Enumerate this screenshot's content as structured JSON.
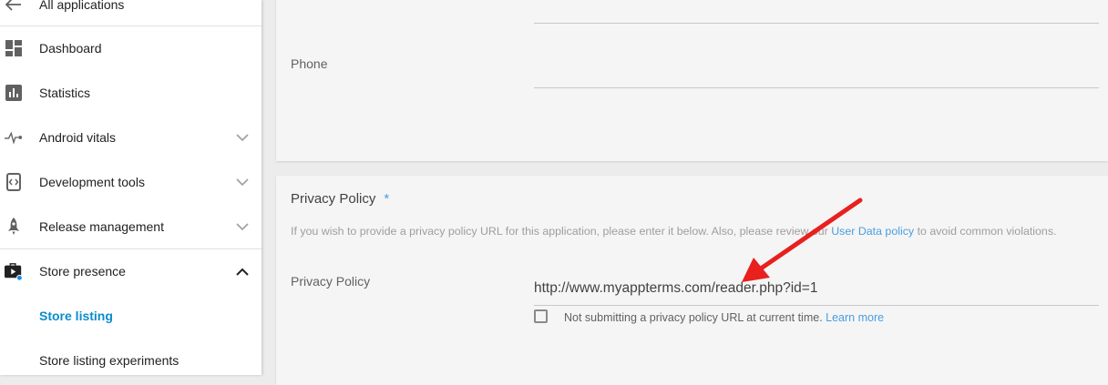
{
  "sidebar": {
    "back_label": "All applications",
    "items": [
      {
        "label": "Dashboard",
        "icon": "dashboard-icon"
      },
      {
        "label": "Statistics",
        "icon": "bar-chart-icon"
      },
      {
        "label": "Android vitals",
        "icon": "pulse-icon"
      },
      {
        "label": "Development tools",
        "icon": "code-icon"
      },
      {
        "label": "Release management",
        "icon": "rocket-icon"
      },
      {
        "label": "Store presence",
        "icon": "store-icon"
      }
    ],
    "sub_items": [
      {
        "label": "Store listing",
        "active": true
      },
      {
        "label": "Store listing experiments",
        "active": false
      }
    ]
  },
  "contact": {
    "phone_label": "Phone"
  },
  "privacy": {
    "title": "Privacy Policy",
    "required_marker": "*",
    "helper_prefix": "If you wish to provide a privacy policy URL for this application, please enter it below. Also, please review our ",
    "helper_link": "User Data policy",
    "helper_suffix": " to avoid common violations.",
    "field_label": "Privacy Policy",
    "url_value": "http://www.myappterms.com/reader.php?id=1",
    "checkbox_label": "Not submitting a privacy policy URL at current time.",
    "learn_more": "Learn more"
  },
  "colors": {
    "accent_blue": "#0b8ccc",
    "link_blue": "#4a9ee0",
    "annotation_arrow": "#e8201e"
  }
}
